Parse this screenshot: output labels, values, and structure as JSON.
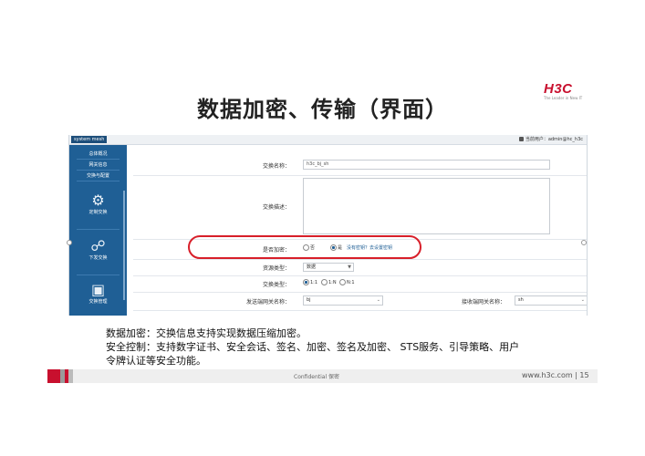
{
  "slide": {
    "title": "数据加密、传输（界面）",
    "logo": {
      "name": "H3C",
      "tagline": "The Leader in New IT"
    },
    "body_lines": [
      "数据加密：交换信息支持实现数据压缩加密。",
      "安全控制：支持数字证书、安全会话、签名、加密、签名及加密、 STS服务、引导策略、用户",
      "令牌认证等安全功能。"
    ],
    "footer": {
      "confidential": "Confidential  保密",
      "url": "www.h3c.com",
      "page": "| 15"
    }
  },
  "app": {
    "menu_label": "system mesh",
    "user_info": "当前用户：admin@hc_h3c",
    "sidebar": {
      "items": [
        "总体概况",
        "网关信息",
        "交换与配置"
      ],
      "big_items": [
        {
          "label": "定制交换",
          "icon": "custom-exchange-icon"
        },
        {
          "label": "下发交换",
          "icon": "dispatch-exchange-icon"
        },
        {
          "label": "交换管理",
          "icon": "exchange-manage-icon"
        }
      ]
    },
    "form": {
      "exchange_name_label": "交换名称：",
      "exchange_name_value": "h3c_bj_sh",
      "exchange_desc_label": "交换描述：",
      "encrypt_label": "是否加密：",
      "encrypt_no": "否",
      "encrypt_yes": "是",
      "encrypt_link": "没有密钥？去设置密钥",
      "resource_type_label": "资源类型：",
      "resource_type_value": "数据",
      "exchange_type_label": "交换类型：",
      "exchange_type_options": [
        "1:1",
        "1:N",
        "N:1"
      ],
      "sender_label": "发送端网关名称：",
      "sender_value": "bj",
      "receiver_label": "接收端网关名称：",
      "receiver_value": "sh"
    }
  }
}
